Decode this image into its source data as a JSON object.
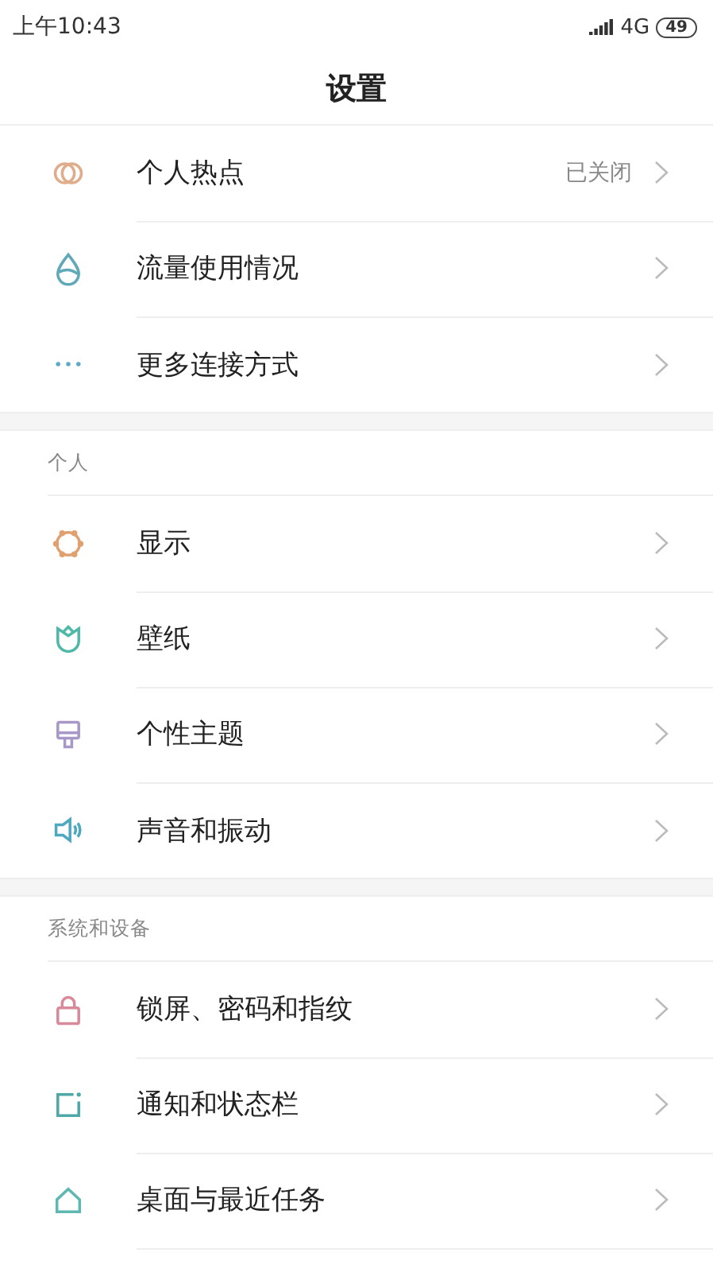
{
  "status_bar": {
    "time": "上午10:43",
    "network": "4G",
    "battery": "49"
  },
  "title": "设置",
  "sections": [
    {
      "items": [
        {
          "kind": "rings",
          "color": "#e0ad8c",
          "label": "个人热点",
          "value": "已关闭"
        },
        {
          "kind": "drop",
          "color": "#5fa9b8",
          "label": "流量使用情况"
        },
        {
          "kind": "dots",
          "color": "#5fa9c8",
          "label": "更多连接方式"
        }
      ]
    },
    {
      "header": "个人",
      "items": [
        {
          "kind": "sun",
          "color": "#e0a070",
          "label": "显示"
        },
        {
          "kind": "tulip",
          "color": "#4fb8a8",
          "label": "壁纸"
        },
        {
          "kind": "brush",
          "color": "#a898c8",
          "label": "个性主题"
        },
        {
          "kind": "speaker",
          "color": "#4fa8c0",
          "label": "声音和振动"
        }
      ]
    },
    {
      "header": "系统和设备",
      "items": [
        {
          "kind": "lock",
          "color": "#d88a9a",
          "label": "锁屏、密码和指纹"
        },
        {
          "kind": "notice",
          "color": "#4fa8a8",
          "label": "通知和状态栏"
        },
        {
          "kind": "home",
          "color": "#5fb8b0",
          "label": "桌面与最近任务"
        }
      ]
    }
  ]
}
